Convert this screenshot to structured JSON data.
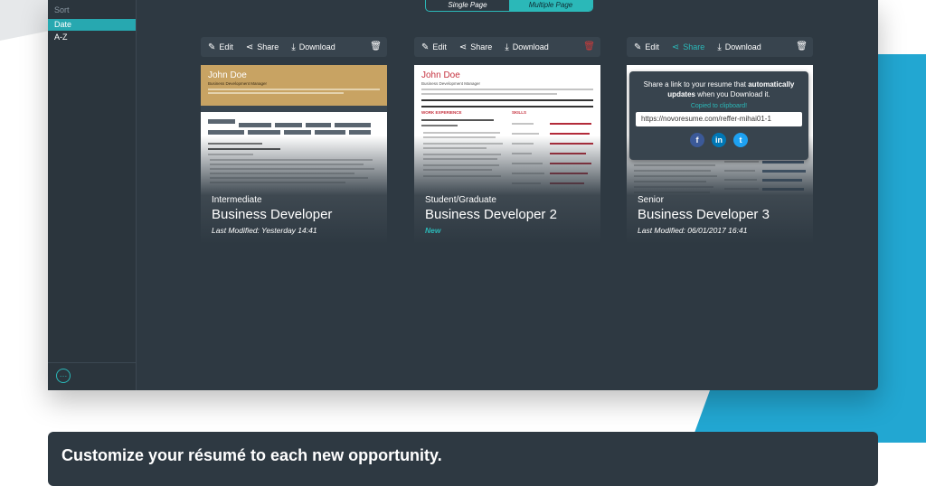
{
  "sidebar": {
    "sort_label": "Sort",
    "options": [
      {
        "label": "Date",
        "active": true
      },
      {
        "label": "A-Z",
        "active": false
      }
    ]
  },
  "view_toggle": {
    "single": "Single Page",
    "multiple": "Multiple Page",
    "selected": "Multiple Page"
  },
  "toolbar": {
    "edit": "Edit",
    "share": "Share",
    "download": "Download"
  },
  "cards": [
    {
      "level": "Intermediate",
      "title": "Business Developer",
      "modified": "Last Modified: Yesterday 14:41",
      "preview_name": "John Doe",
      "preview_title": "Business Development Manager"
    },
    {
      "level": "Student/Graduate",
      "title": "Business Developer 2",
      "modified": "New",
      "preview_name": "John Doe",
      "preview_title": "Business Development Manager"
    },
    {
      "level": "Senior",
      "title": "Business Developer 3",
      "modified": "Last Modified: 06/01/2017 16:41"
    }
  ],
  "share_popup": {
    "message_start": "Share a link to your resume that ",
    "message_bold": "automatically updates",
    "message_end": " when you Download it.",
    "copied": "Copied to clipboard!",
    "link": "https://novoresume.com/reffer-mihai01-1",
    "socials": [
      "facebook-icon",
      "linkedin-icon",
      "twitter-icon"
    ]
  },
  "footer": {
    "heading": "Customize your résumé to each new opportunity."
  },
  "colors": {
    "accent": "#2bb8b8",
    "panel": "#2e3942",
    "brand_blue": "#22a7d2",
    "delete_red": "#cc3b3b"
  }
}
